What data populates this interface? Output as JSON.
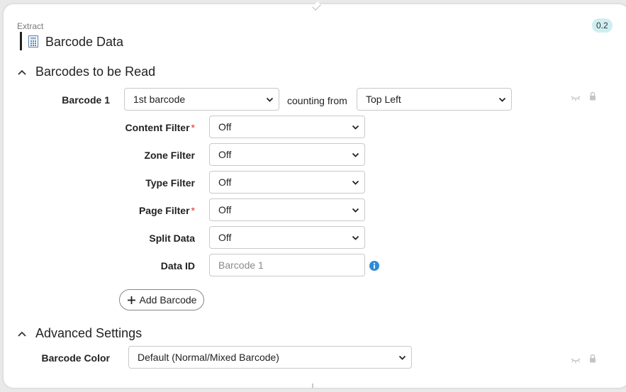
{
  "header": {
    "caption": "Extract",
    "title": "Barcode Data",
    "version": "0.2",
    "title_icon": "barcode-doc-icon"
  },
  "sections": {
    "barcodes": {
      "title": "Barcodes to be Read"
    },
    "advanced": {
      "title": "Advanced Settings"
    }
  },
  "barcode1": {
    "label": "Barcode 1",
    "selected": "1st barcode",
    "counting_label": "counting from",
    "counting_selected": "Top Left"
  },
  "filters": {
    "content": {
      "label": "Content Filter",
      "value": "Off",
      "required": "*"
    },
    "zone": {
      "label": "Zone Filter",
      "value": "Off"
    },
    "type": {
      "label": "Type Filter",
      "value": "Off"
    },
    "page": {
      "label": "Page Filter",
      "value": "Off",
      "required": "*"
    },
    "split": {
      "label": "Split Data",
      "value": "Off"
    },
    "data_id": {
      "label": "Data ID",
      "placeholder": "Barcode 1"
    }
  },
  "add_button": {
    "label": "Add Barcode"
  },
  "advanced": {
    "color_label": "Barcode Color",
    "color_selected": "Default (Normal/Mixed Barcode)"
  },
  "colors": {
    "badge_bg": "#cfeef2",
    "info_blue": "#2e8bd6",
    "required_red": "#d9302c"
  }
}
